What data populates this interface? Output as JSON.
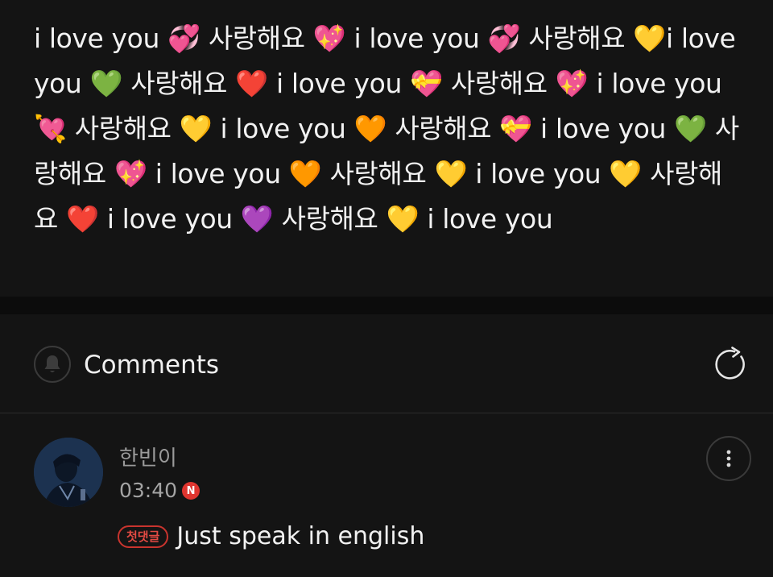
{
  "post": {
    "text": "i love you 💞 사랑해요 💖 i love you 💞 사랑해요 💛i love you 💚 사랑해요 ❤️ i love you 💝 사랑해요 💖 i love you 💘 사랑해요 💛 i love you 🧡 사랑해요 💝 i love you 💚 사랑해요 💖 i love you 🧡 사랑해요 💛 i love you 💛 사랑해요 ❤️ i love you 💜 사랑해요 💛 i love you"
  },
  "comments_section": {
    "title": "Comments",
    "bell_icon": "bell-icon",
    "refresh_icon": "refresh-icon"
  },
  "comment": {
    "username": "한빈이",
    "timestamp": "03:40",
    "new_badge": "N",
    "first_comment_badge": "첫댓글",
    "text": "Just speak in english",
    "more_icon": "more-vertical-icon",
    "colors": {
      "badge_red": "#e0352f",
      "first_badge_red": "#c9342e"
    }
  }
}
